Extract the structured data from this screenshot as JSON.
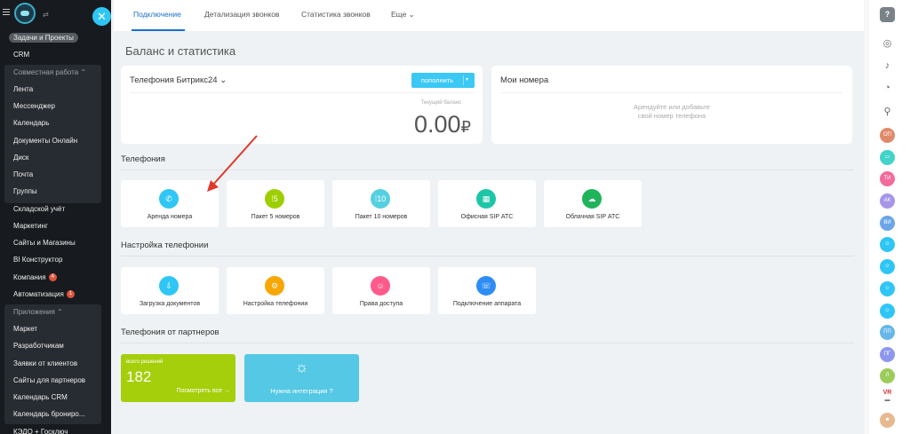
{
  "sidebar": {
    "pill": "Задачи и Проекты",
    "items": [
      "CRM",
      "Совместная работа ⌃",
      "Лента",
      "Мессенджер",
      "Календарь",
      "Документы Онлайн",
      "Диск",
      "Почта",
      "Группы",
      "Складской учёт",
      "Маркетинг",
      "Сайты и Магазины",
      "BI Конструктор",
      "Компания",
      "Автоматизация",
      "Приложения ⌃",
      "Маркет",
      "Разработчикам",
      "Заявки от клиентов",
      "Сайты для партнеров",
      "Календарь CRM",
      "Календарь брониро...",
      "КЭДО + Госключ"
    ],
    "badge_company": "4",
    "badge_automation": "1"
  },
  "fab": "✕",
  "tabs": [
    "Подключение",
    "Детализация звонков",
    "Статистика звонков",
    "Еще ⌄"
  ],
  "page_title": "Баланс и статистика",
  "balance": {
    "title": "Телефония Битрикс24 ⌄",
    "topup": "пополнить",
    "caret": "▾",
    "label": "Текущий баланс",
    "value": "0.00",
    "currency": "₽"
  },
  "numbers": {
    "title": "Мои номера",
    "hint1": "Арендуйте или добавьте",
    "hint2": "свой номер телефона"
  },
  "sections": [
    "Телефония",
    "Настройка телефонии",
    "Телефония от партнеров"
  ],
  "telephony_tiles": [
    {
      "label": "Аренда номера",
      "icon": "phone-number-icon",
      "glyph": "✆",
      "color": "#2fc6f6"
    },
    {
      "label": "Пакет 5 номеров",
      "icon": "package-5-icon",
      "glyph": "⁞5",
      "color": "#9dcf00"
    },
    {
      "label": "Пакет 10 номеров",
      "icon": "package-10-icon",
      "glyph": "⁞10",
      "color": "#55d0e0"
    },
    {
      "label": "Офисная SIP АТС",
      "icon": "office-sip-icon",
      "glyph": "▦",
      "color": "#1ec6a8"
    },
    {
      "label": "Облачная SIP АТС",
      "icon": "cloud-sip-icon",
      "glyph": "☁",
      "color": "#1fb35a"
    }
  ],
  "settings_tiles": [
    {
      "label": "Загрузка документов",
      "icon": "upload-documents-icon",
      "glyph": "⇩",
      "color": "#2fc6f6"
    },
    {
      "label": "Настройка телефонии",
      "icon": "telephony-settings-icon",
      "glyph": "⚙",
      "color": "#f7a700"
    },
    {
      "label": "Права доступа",
      "icon": "access-rights-icon",
      "glyph": "☺",
      "color": "#ff5b8a"
    },
    {
      "label": "Подключение аппарата",
      "icon": "device-connect-icon",
      "glyph": "☏",
      "color": "#2d8df5"
    }
  ],
  "partners": {
    "count_label": "всего решений",
    "count": "182",
    "view_all": "Посмотреть все →",
    "integration": "Нужна интеграция ?",
    "bulb": "☼"
  },
  "right_panel": {
    "help": "?",
    "avatars": [
      "ОП",
      "ТИ",
      "АК",
      "ВИ",
      "ПП",
      "ПГ",
      "Л"
    ]
  }
}
